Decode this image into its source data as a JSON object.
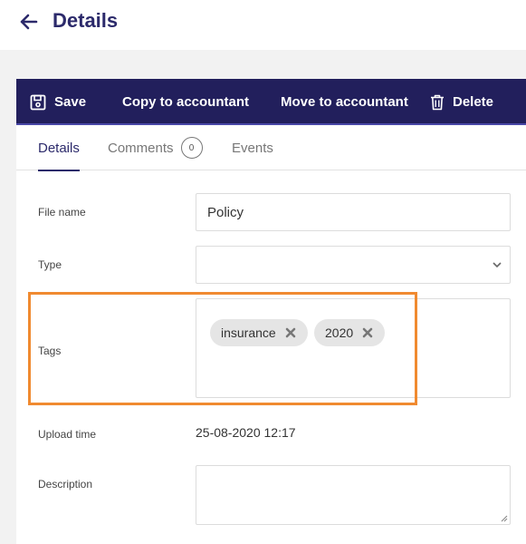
{
  "header": {
    "title": "Details"
  },
  "toolbar": {
    "save_label": "Save",
    "copy_label": "Copy to accountant",
    "move_label": "Move to accountant",
    "delete_label": "Delete"
  },
  "tabs": {
    "details_label": "Details",
    "comments_label": "Comments",
    "comments_count": "0",
    "events_label": "Events"
  },
  "form": {
    "file_name_label": "File name",
    "file_name_value": "Policy",
    "type_label": "Type",
    "type_value": "",
    "tags_label": "Tags",
    "tags": [
      "insurance",
      "2020"
    ],
    "upload_time_label": "Upload time",
    "upload_time_value": "25-08-2020 12:17",
    "description_label": "Description",
    "description_value": ""
  },
  "colors": {
    "primary": "#221f5c",
    "title": "#2c2a6b",
    "highlight": "#f08a30",
    "tag_bg": "#e5e5e5"
  },
  "icons": {
    "back": "arrow-left-icon",
    "save": "floppy-disk-icon",
    "delete": "trash-icon",
    "select": "chevron-down-icon",
    "tag_remove": "close-icon"
  }
}
